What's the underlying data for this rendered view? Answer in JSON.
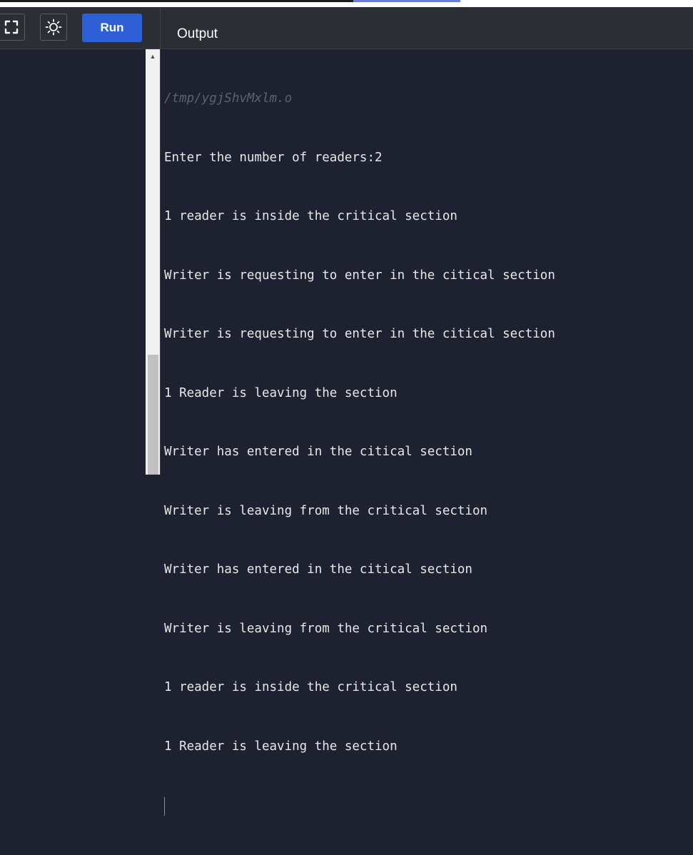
{
  "toolbar": {
    "fullscreen_icon": "fullscreen-icon",
    "theme_icon": "sun-icon",
    "run_label": "Run",
    "output_title": "Output"
  },
  "colors": {
    "run_button": "#2d5fd6",
    "background": "#1d2130",
    "toolbar": "#2b2e34"
  },
  "console": {
    "path": "/tmp/ygjShvMxlm.o",
    "lines": [
      "Enter the number of readers:2",
      "1 reader is inside the critical section",
      "Writer is requesting to enter in the citical section",
      "Writer is requesting to enter in the citical section",
      "1 Reader is leaving the section",
      "Writer has entered in the citical section",
      "Writer is leaving from the critical section",
      "Writer has entered in the citical section",
      "Writer is leaving from the critical section",
      "1 reader is inside the critical section",
      "1 Reader is leaving the section"
    ]
  }
}
